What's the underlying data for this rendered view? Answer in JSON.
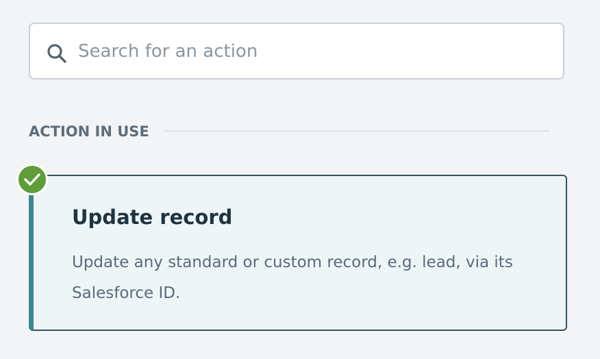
{
  "search": {
    "placeholder": "Search for an action",
    "value": "",
    "icon": "search-icon"
  },
  "section": {
    "title": "ACTION IN USE"
  },
  "action": {
    "title": "Update record",
    "description": "Update any standard or custom record, e.g. lead, via its Salesforce ID.",
    "status_icon": "check-icon",
    "in_use": true
  },
  "colors": {
    "background": "#f3f4f6",
    "card_background": "#edf5f7",
    "card_accent": "#3b8893",
    "card_border": "#35525f",
    "check_badge": "#5f9d3b",
    "section_title": "#5d6e7c"
  }
}
